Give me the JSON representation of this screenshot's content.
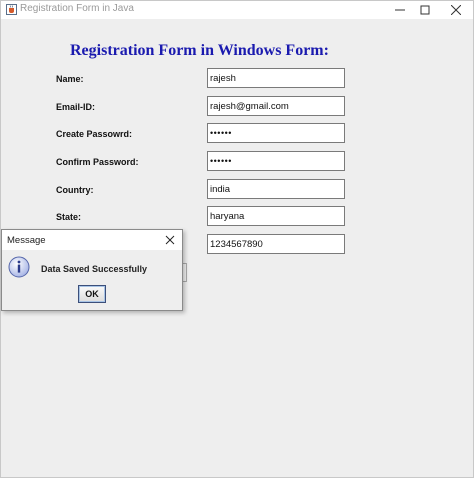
{
  "window": {
    "title": "Registration Form in Java",
    "icon": "java-cup-icon",
    "controls": [
      "minimize-icon",
      "maximize-icon",
      "close-icon"
    ]
  },
  "form": {
    "heading": "Registration Form in Windows Form:",
    "heading_color": "#1a1aaf",
    "fields": {
      "name": {
        "label": "Name:",
        "value": "rajesh"
      },
      "email": {
        "label": "Email-ID:",
        "value": "rajesh@gmail.com"
      },
      "create_password": {
        "label": "Create Passowrd:",
        "value": "••••••"
      },
      "confirm_password": {
        "label": "Confirm Password:",
        "value": "••••••"
      },
      "country": {
        "label": "Country:",
        "value": "india"
      },
      "state": {
        "label": "State:",
        "value": "haryana"
      },
      "phone": {
        "value": "1234567890"
      }
    }
  },
  "dialog": {
    "title": "Message",
    "icon": "info-icon",
    "message": "Data Saved Successfully",
    "ok_label": "OK"
  }
}
